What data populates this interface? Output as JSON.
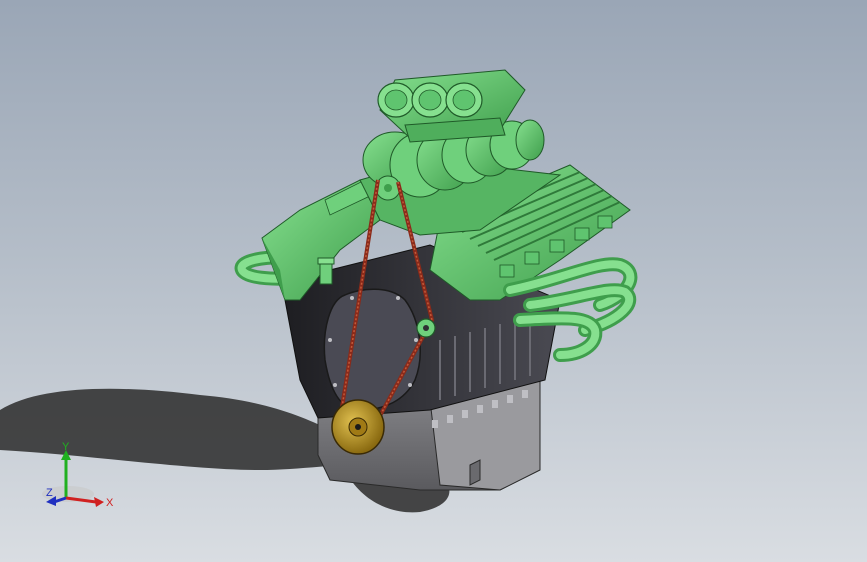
{
  "viewport": {
    "background_top": "#9aa6b6",
    "background_bottom": "#d9dde2"
  },
  "model": {
    "part_color": "#5fc46f",
    "part_dark_color": "#2f2f33",
    "pulley_color": "#b08a1a",
    "belt_color": "#8a2a1a"
  },
  "triad": {
    "x_label": "X",
    "y_label": "Y",
    "z_label": "Z",
    "x_color": "#d02020",
    "y_color": "#20b020",
    "z_color": "#2030c0"
  }
}
